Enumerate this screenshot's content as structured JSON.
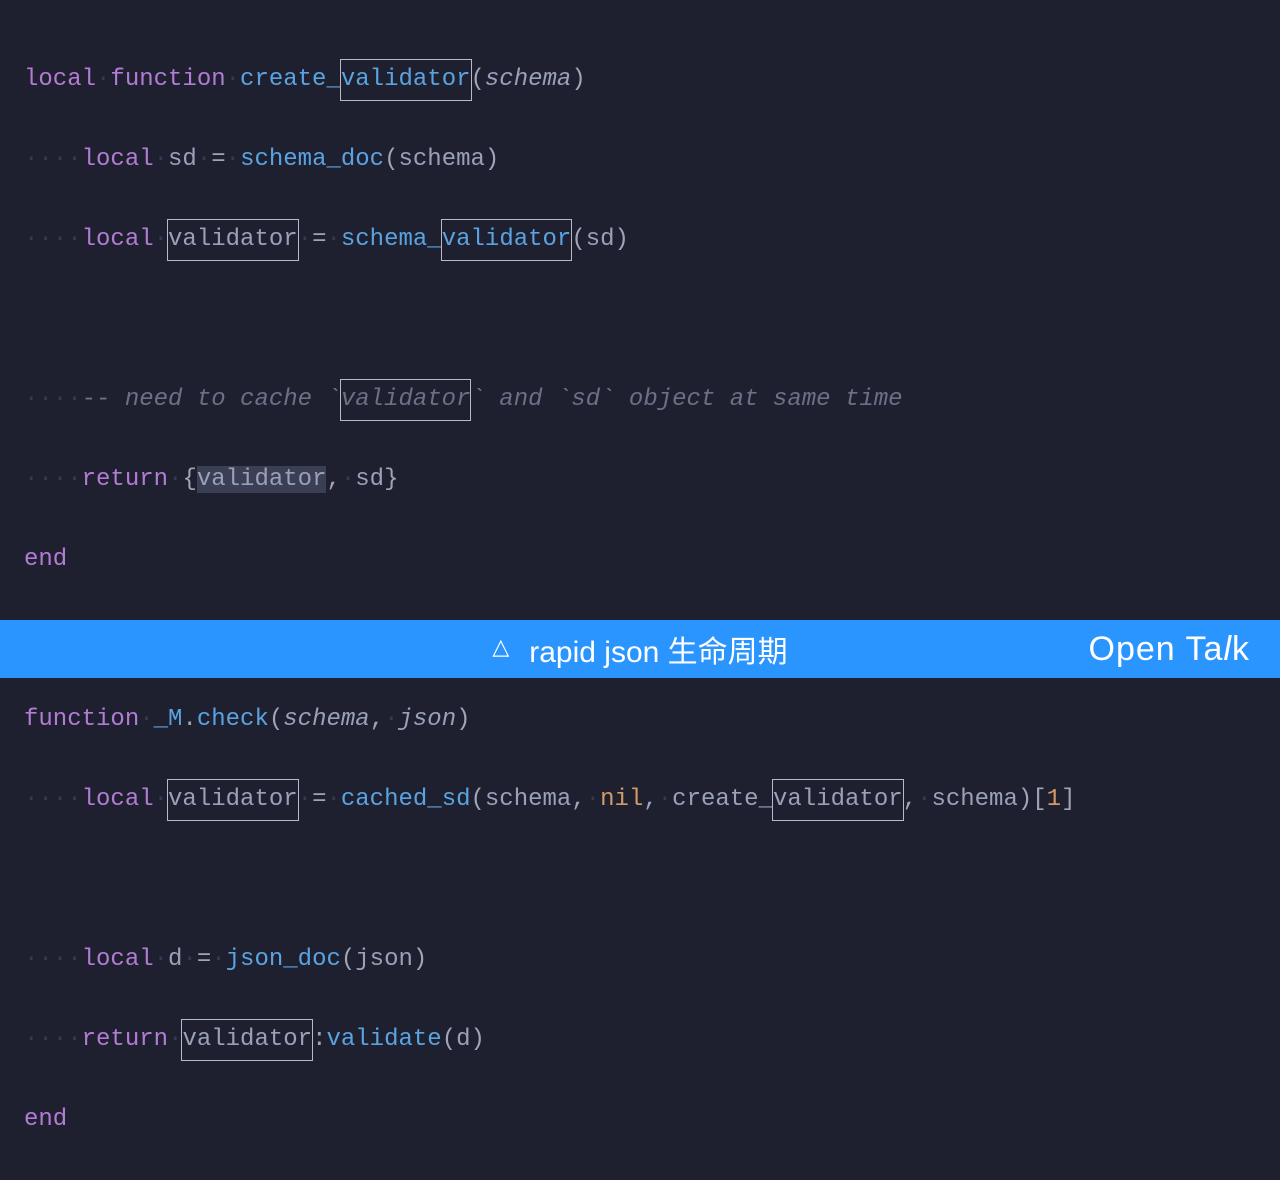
{
  "code": {
    "line1": {
      "kw1": "local",
      "kw2": "function",
      "fn_pre": "create_",
      "fn_box": "validator",
      "paren_open": "(",
      "param": "schema",
      "paren_close": ")"
    },
    "line2": {
      "kw": "local",
      "v": "sd",
      "eq": "=",
      "fn": "schema_doc",
      "po": "(",
      "arg": "schema",
      "pc": ")"
    },
    "line3": {
      "kw": "local",
      "var_box": "validator",
      "eq": "=",
      "fn_pre": "schema_",
      "fn_box": "validator",
      "po": "(",
      "arg": "sd",
      "pc": ")"
    },
    "line5": {
      "prefix": "-- need to cache `",
      "box": "validator",
      "suffix": "` and `sd` object at same time"
    },
    "line6": {
      "kw": "return",
      "brace_o": "{",
      "v1": "validator",
      "comma": ",",
      "v2": "sd",
      "brace_c": "}"
    },
    "line7": {
      "end": "end"
    },
    "line9": {
      "kw": "function",
      "ns": "_M",
      "dot": ".",
      "fn": "check",
      "po": "(",
      "p1": "schema",
      "comma": ",",
      "p2": "json",
      "pc": ")"
    },
    "line10": {
      "kw": "local",
      "var_box": "validator",
      "eq": "=",
      "fn": "cached_sd",
      "po": "(",
      "a1": "schema",
      "c1": ",",
      "nil": "nil",
      "c2": ",",
      "cv_pre": "create_",
      "cv_box": "validator",
      "c3": ",",
      "a4": "schema",
      "pc": ")",
      "bo": "[",
      "idx": "1",
      "bc": "]"
    },
    "line12": {
      "kw": "local",
      "v": "d",
      "eq": "=",
      "fn": "json_doc",
      "po": "(",
      "arg": "json",
      "pc": ")"
    },
    "line13": {
      "kw": "return",
      "obj_box": "validator",
      "colon": ":",
      "fn": "validate",
      "po": "(",
      "arg": "d",
      "pc": ")"
    },
    "line14": {
      "end": "end"
    },
    "ws4": "····",
    "ws1": "·"
  },
  "footer": {
    "triangle": "△",
    "title": "rapid json 生命周期",
    "brand_open": "Open Ta",
    "brand_slant": "l",
    "brand_close": "k"
  }
}
